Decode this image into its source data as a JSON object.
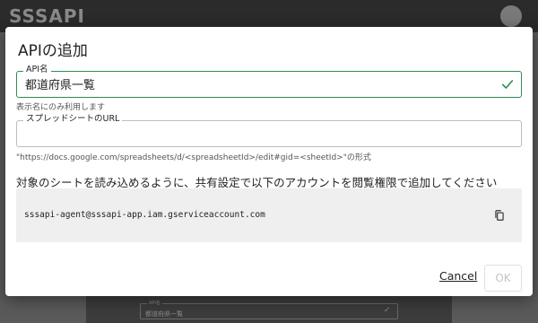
{
  "app": {
    "logo": "SSSAPI",
    "bg_field_label": "API名",
    "bg_field_value": "都道府県一覧"
  },
  "dialog": {
    "title": "APIの追加",
    "name_field": {
      "label": "API名",
      "value": "都道府県一覧",
      "helper": "表示名にのみ利用します"
    },
    "url_field": {
      "label": "スプレッドシートのURL",
      "value": "",
      "helper": "\"https://docs.google.com/spreadsheets/d/<spreadsheetId>/edit#gid=<sheetId>\"の形式"
    },
    "instruction": "対象のシートを読み込めるように、共有設定で以下のアカウントを閲覧権限で追加してください",
    "service_account": "sssapi-agent@sssapi-app.iam.gserviceaccount.com",
    "cancel_label": "Cancel",
    "ok_label": "OK"
  },
  "colors": {
    "accent": "#2e8b57",
    "dialog_bg": "#ffffff",
    "account_box_bg": "#efefef"
  },
  "icons": {
    "valid": "check-icon",
    "copy": "copy-icon"
  }
}
